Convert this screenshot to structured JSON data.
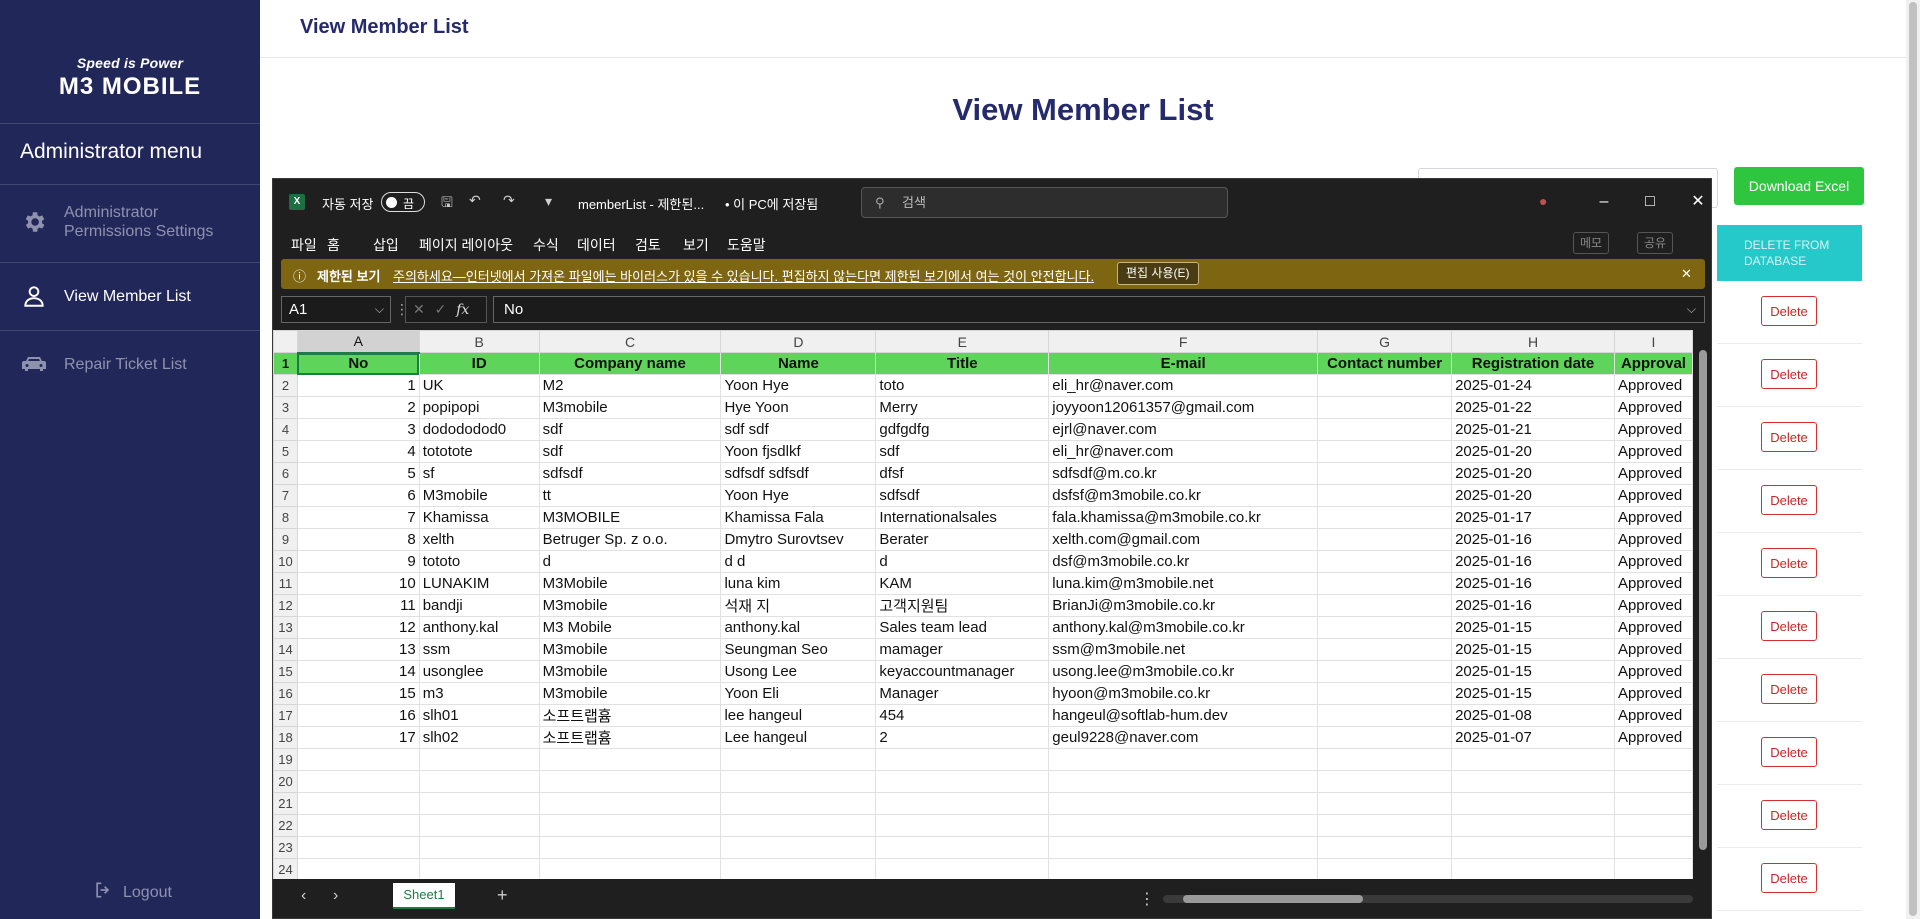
{
  "sidebar": {
    "tagline": "Speed is Power",
    "brand": "M3 MOBILE",
    "menu_title": "Administrator menu",
    "items": [
      {
        "label": "Administrator Permissions Settings",
        "icon": "gear-icon",
        "active": false
      },
      {
        "label": "View Member List",
        "icon": "user-icon",
        "active": true
      },
      {
        "label": "Repair Ticket List",
        "icon": "car-repair-icon",
        "active": false
      }
    ],
    "logout_label": "Logout"
  },
  "topbar": {
    "title": "View Member List"
  },
  "main": {
    "heading": "View Member List",
    "download_label": "Download Excel",
    "delete_header": "DELETE FROM DATABASE",
    "delete_label": "Delete"
  },
  "excel": {
    "autosave_label": "자동 저장",
    "autosave_state": "끔",
    "filename": "memberList  -  제한된...",
    "saved_state": "• 이 PC에 저장됨",
    "search_placeholder": "검색",
    "menu": [
      "파일",
      "홈",
      "삽입",
      "페이지 레이아웃",
      "수식",
      "데이터",
      "검토",
      "보기",
      "도움말"
    ],
    "memo_label": "메모",
    "share_label": "공유",
    "warning_title": "제한된 보기",
    "warning_text": "주의하세요—인터넷에서 가져온 파일에는 바이러스가 있을 수 있습니다. 편집하지 않는다면 제한된 보기에서 여는 것이 안전합니다.",
    "enable_edit_label": "편집 사용(E)",
    "name_box": "A1",
    "formula_value": "No",
    "sheet_tab": "Sheet1",
    "columns": [
      "A",
      "B",
      "C",
      "D",
      "E",
      "F",
      "G",
      "H",
      "I"
    ],
    "header_row": [
      "No",
      "ID",
      "Company name",
      "Name",
      "Title",
      "E-mail",
      "Contact number",
      "Registration date",
      "Approval"
    ],
    "rows": [
      [
        "1",
        "UK",
        "M2",
        "Yoon Hye",
        "toto",
        "eli_hr@naver.com",
        "",
        "2025-01-24",
        "Approved"
      ],
      [
        "2",
        "popipopi",
        "M3mobile",
        "Hye Yoon",
        "Merry",
        "joyyoon12061357@gmail.com",
        "",
        "2025-01-22",
        "Approved"
      ],
      [
        "3",
        "dodododod0",
        "sdf",
        "sdf sdf",
        "gdfgdfg",
        "ejrl@naver.com",
        "",
        "2025-01-21",
        "Approved"
      ],
      [
        "4",
        "tototote",
        "sdf",
        "Yoon fjsdlkf",
        "sdf",
        "eli_hr@naver.com",
        "",
        "2025-01-20",
        "Approved"
      ],
      [
        "5",
        "sf",
        "sdfsdf",
        "sdfsdf sdfsdf",
        "dfsf",
        "sdfsdf@m.co.kr",
        "",
        "2025-01-20",
        "Approved"
      ],
      [
        "6",
        "M3mobile",
        "tt",
        "Yoon Hye",
        "sdfsdf",
        "dsfsf@m3mobile.co.kr",
        "",
        "2025-01-20",
        "Approved"
      ],
      [
        "7",
        "Khamissa",
        "M3MOBILE",
        "Khamissa Fala",
        "Internationalsales",
        "fala.khamissa@m3mobile.co.kr",
        "",
        "2025-01-17",
        "Approved"
      ],
      [
        "8",
        "xelth",
        "Betruger Sp. z o.o.",
        "Dmytro Surovtsev",
        "Berater",
        "xelth.com@gmail.com",
        "",
        "2025-01-16",
        "Approved"
      ],
      [
        "9",
        "tototo",
        "d",
        "d d",
        "d",
        "dsf@m3mobile.co.kr",
        "",
        "2025-01-16",
        "Approved"
      ],
      [
        "10",
        "LUNAKIM",
        "M3Mobile",
        "luna kim",
        "KAM",
        "luna.kim@m3mobile.net",
        "",
        "2025-01-16",
        "Approved"
      ],
      [
        "11",
        "bandji",
        "M3mobile",
        "석재 지",
        "고객지원팀",
        "BrianJi@m3mobile.co.kr",
        "",
        "2025-01-16",
        "Approved"
      ],
      [
        "12",
        "anthony.kal",
        "M3 Mobile",
        "anthony.kal",
        "Sales team lead",
        "anthony.kal@m3mobile.co.kr",
        "",
        "2025-01-15",
        "Approved"
      ],
      [
        "13",
        "ssm",
        "M3mobile",
        "Seungman Seo",
        "mamager",
        "ssm@m3mobile.net",
        "",
        "2025-01-15",
        "Approved"
      ],
      [
        "14",
        "usonglee",
        "M3mobile",
        "Usong Lee",
        "keyaccountmanager",
        "usong.lee@m3mobile.co.kr",
        "",
        "2025-01-15",
        "Approved"
      ],
      [
        "15",
        "m3",
        "M3mobile",
        "Yoon Eli",
        "Manager",
        "hyoon@m3mobile.co.kr",
        "",
        "2025-01-15",
        "Approved"
      ],
      [
        "16",
        "slh01",
        "소프트랩흄",
        "lee hangeul",
        "454",
        "hangeul@softlab-hum.dev",
        "",
        "2025-01-08",
        "Approved"
      ],
      [
        "17",
        "slh02",
        "소프트랩흄",
        "Lee hangeul",
        "2",
        "geul9228@naver.com",
        "",
        "2025-01-07",
        "Approved"
      ],
      [
        "",
        "",
        "",
        "",
        "",
        "",
        "",
        "",
        ""
      ],
      [
        "",
        "",
        "",
        "",
        "",
        "",
        "",
        "",
        ""
      ],
      [
        "",
        "",
        "",
        "",
        "",
        "",
        "",
        "",
        ""
      ],
      [
        "",
        "",
        "",
        "",
        "",
        "",
        "",
        "",
        ""
      ],
      [
        "",
        "",
        "",
        "",
        "",
        "",
        "",
        "",
        ""
      ],
      [
        "",
        "",
        "",
        "",
        "",
        "",
        "",
        "",
        ""
      ]
    ]
  },
  "colors": {
    "sidebar_bg": "#22275a",
    "title_navy": "#242a6b",
    "download_green": "#2ec63e",
    "header_teal": "#26c9c9",
    "delete_red": "#d32f2f",
    "excel_header_green": "#5ed45a",
    "warning_gold": "#7e6511"
  }
}
